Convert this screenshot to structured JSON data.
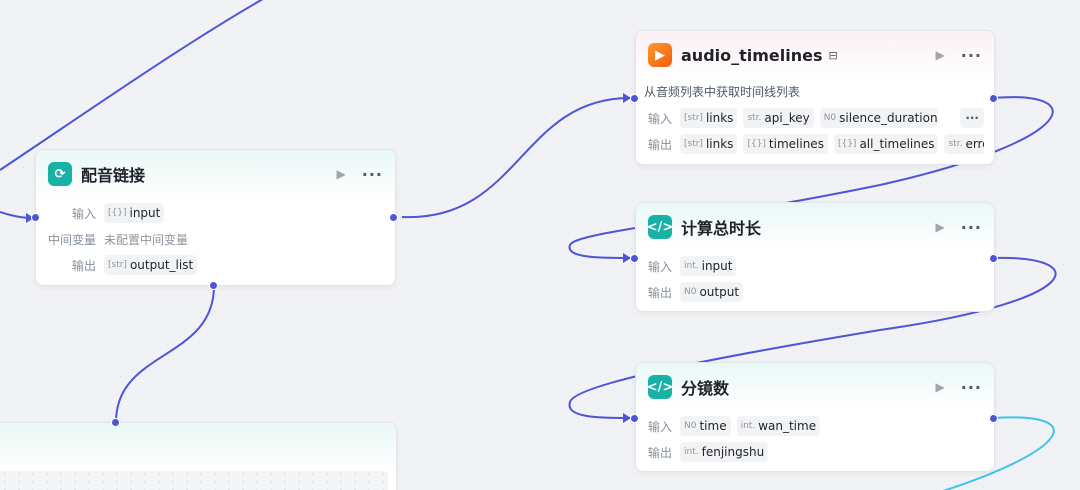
{
  "colors": {
    "edge": "#4e55d6",
    "edge_active": "#3ec4e8",
    "teal_icon": "#17b2a5",
    "orange_icon": "#f46d1a"
  },
  "nodes": {
    "peiyin": {
      "title": "配音链接",
      "icon": "loop-icon",
      "input_label": "输入",
      "inputs": [
        {
          "type": "[{}]",
          "name": "input"
        }
      ],
      "mid_label": "中间变量",
      "mid_value": "未配置中间变量",
      "output_label": "输出",
      "outputs": [
        {
          "type": "[str]",
          "name": "output_list"
        }
      ]
    },
    "audio": {
      "title": "audio_timelines",
      "icon": "video-plugin-icon",
      "badge": "plugin-badge-icon",
      "description": "从音频列表中获取时间线列表",
      "input_label": "输入",
      "inputs": [
        {
          "type": "[str]",
          "name": "links"
        },
        {
          "type": "str.",
          "name": "api_key"
        },
        {
          "type": "N0",
          "name": "silence_duration"
        }
      ],
      "more": "···",
      "output_label": "输出",
      "outputs": [
        {
          "type": "[str]",
          "name": "links"
        },
        {
          "type": "[{}]",
          "name": "timelines"
        },
        {
          "type": "[{}]",
          "name": "all_timelines"
        },
        {
          "type": "str.",
          "name": "error"
        }
      ]
    },
    "total": {
      "title": "计算总时长",
      "icon": "code-icon",
      "input_label": "输入",
      "inputs": [
        {
          "type": "int.",
          "name": "input"
        }
      ],
      "output_label": "输出",
      "outputs": [
        {
          "type": "N0",
          "name": "output"
        }
      ]
    },
    "fenjing": {
      "title": "分镜数",
      "icon": "code-icon",
      "input_label": "输入",
      "inputs": [
        {
          "type": "N0",
          "name": "time"
        },
        {
          "type": "int.",
          "name": "wan_time"
        }
      ],
      "output_label": "输出",
      "outputs": [
        {
          "type": "int.",
          "name": "fenjingshu"
        }
      ]
    }
  }
}
